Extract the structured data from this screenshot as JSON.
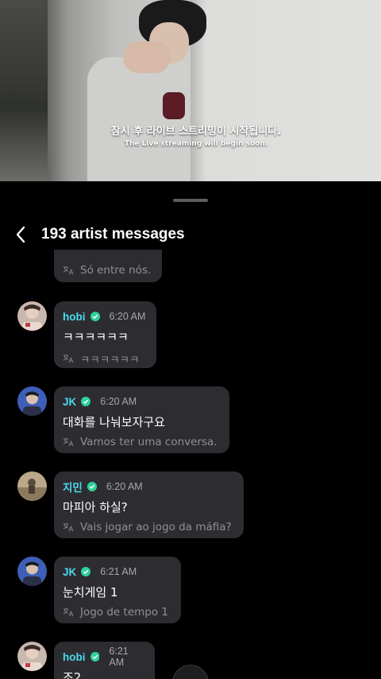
{
  "video": {
    "caption_ko": "잠시 후 라이브 스트리밍이 시작됩니다.",
    "caption_en": "The Live streaming will begin soon."
  },
  "header": {
    "title": "193 artist messages"
  },
  "first_partial": {
    "translation": "Só entre nós."
  },
  "messages": [
    {
      "name": "hobi",
      "time": "6:20 AM",
      "text": "ㅋㅋㅋㅋㅋㅋ",
      "translation": "ㅋㅋㅋㅋㅋㅋ",
      "avatar": "hobi"
    },
    {
      "name": "JK",
      "time": "6:20 AM",
      "text": "대화를 나눠보자구요",
      "translation": "Vamos ter uma conversa.",
      "avatar": "jk"
    },
    {
      "name": "지민",
      "time": "6:20 AM",
      "text": "마피아 하실?",
      "translation": "Vais jogar ao jogo da máfia?",
      "avatar": "jimin"
    },
    {
      "name": "JK",
      "time": "6:21 AM",
      "text": "눈치게임 1",
      "translation": "Jogo de tempo 1",
      "avatar": "jk"
    },
    {
      "name": "hobi",
      "time": "6:21 AM",
      "text": "조2",
      "translation": "",
      "avatar": "hobi"
    }
  ],
  "colors": {
    "name": "#49d9ee",
    "bubble": "#2d2d31",
    "verified": "#2fd19b"
  },
  "icons": {
    "back": "chevron-left-icon",
    "verified": "verified-badge-icon",
    "translate": "translate-icon"
  }
}
